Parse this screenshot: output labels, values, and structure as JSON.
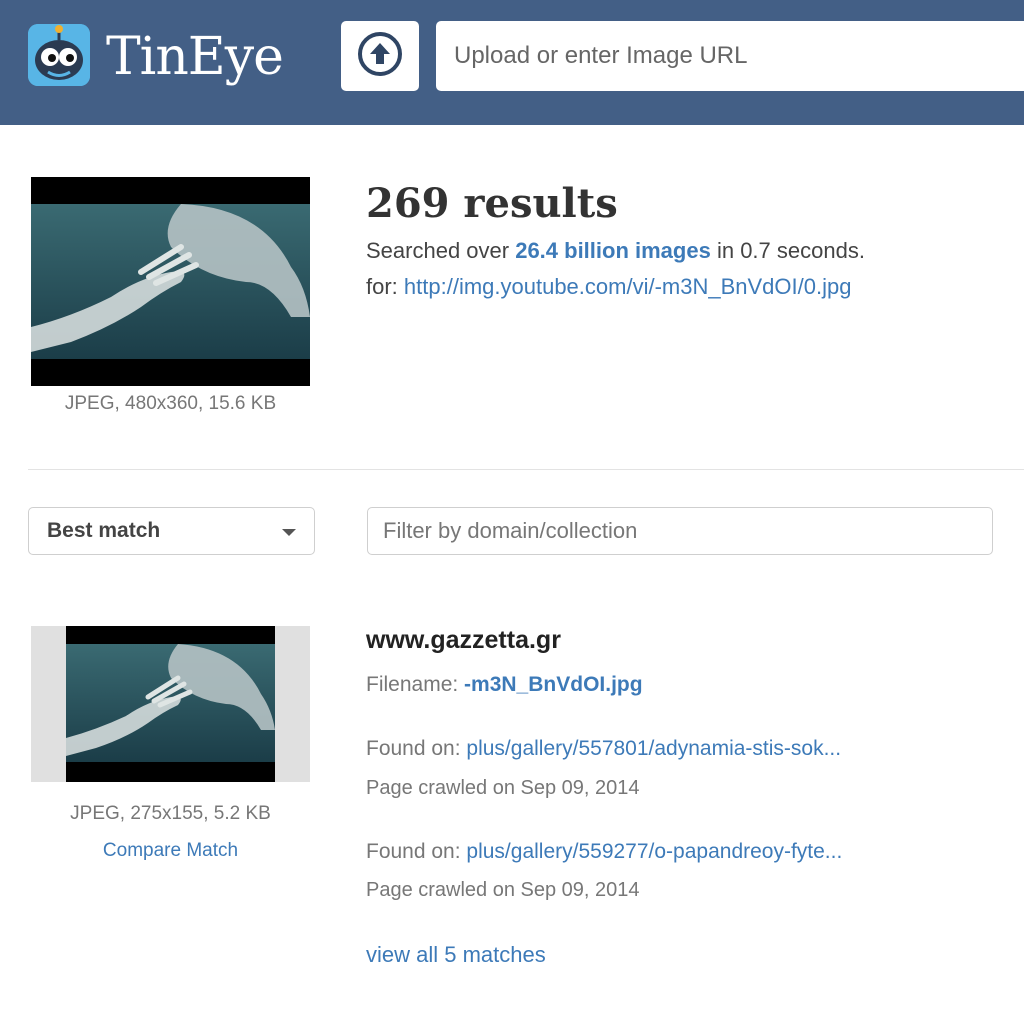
{
  "header": {
    "logo_text": "TinEye",
    "search_placeholder": "Upload or enter Image URL",
    "colors": {
      "bar": "#435f86",
      "logo_bg": "#58b5e6"
    }
  },
  "query": {
    "image_meta": "JPEG, 480x360, 15.6 KB",
    "results_count": "269 results",
    "searched_prefix": "Searched over ",
    "searched_bold": "26.4 billion images",
    "searched_suffix": " in 0.7 seconds.",
    "for_label": "for: ",
    "for_url": "http://img.youtube.com/vi/-m3N_BnVdOI/0.jpg"
  },
  "controls": {
    "sort_selected": "Best match",
    "filter_placeholder": "Filter by domain/collection"
  },
  "result": {
    "image_meta": "JPEG, 275x155, 5.2 KB",
    "compare_label": "Compare Match",
    "domain": "www.gazzetta.gr",
    "filename_label": "Filename: ",
    "filename": "-m3N_BnVdOI.jpg",
    "found_on_label": "Found on: ",
    "matches": [
      {
        "url": "plus/gallery/557801/adynamia-stis-sok...",
        "crawled": "Page crawled on Sep 09, 2014"
      },
      {
        "url": "plus/gallery/559277/o-papandreoy-fyte...",
        "crawled": "Page crawled on Sep 09, 2014"
      }
    ],
    "view_all": "view all 5 matches"
  },
  "icons": {
    "upload": "upload-arrow-icon",
    "logo": "tineye-robot-icon",
    "sort": "caret-down-icon"
  },
  "colors": {
    "link": "#3d7ab8"
  }
}
